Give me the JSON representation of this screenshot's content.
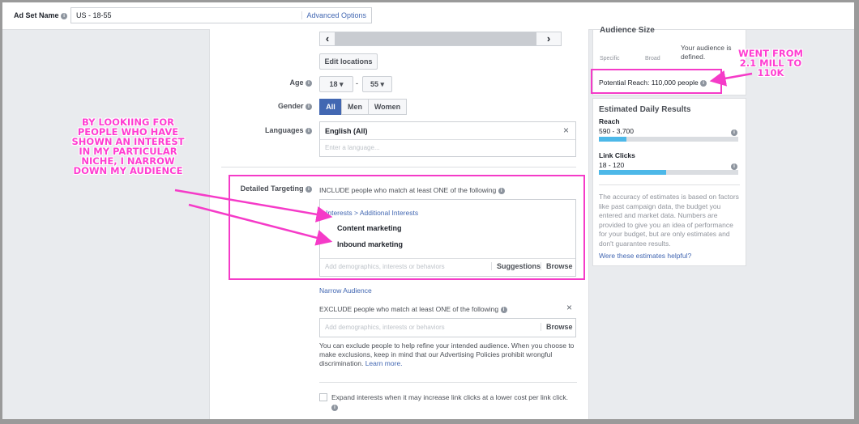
{
  "topbar": {
    "label": "Ad Set Name",
    "value": "US - 18-55",
    "advanced_link": "Advanced Options"
  },
  "location": {
    "scroll_left": "‹",
    "scroll_right": "›",
    "edit_button": "Edit locations"
  },
  "age": {
    "label": "Age",
    "min": "18",
    "max": "55",
    "separator": "-"
  },
  "gender": {
    "label": "Gender",
    "options": [
      "All",
      "Men",
      "Women"
    ],
    "selected": "All"
  },
  "languages": {
    "label": "Languages",
    "selected": "English (All)",
    "placeholder": "Enter a language..."
  },
  "detailed_targeting": {
    "label": "Detailed Targeting",
    "include_text": "INCLUDE people who match at least ONE of the following",
    "breadcrumb": "Interests > Additional Interests",
    "items": [
      "Content marketing",
      "Inbound marketing"
    ],
    "placeholder": "Add demographics, interests or behaviors",
    "suggestions": "Suggestions",
    "browse": "Browse",
    "narrow_link": "Narrow Audience",
    "exclude_text": "EXCLUDE people who match at least ONE of the following",
    "exclude_placeholder": "Add demographics, interests or behaviors",
    "exclude_browse": "Browse",
    "exclude_help": "You can exclude people to help refine your intended audience. When you choose to make exclusions, keep in mind that our Advertising Policies prohibit wrongful discrimination.",
    "learn_more": "Learn more.",
    "expand_label": "Expand interests when it may increase link clicks at a lower cost per link click."
  },
  "audience_size": {
    "title": "Audience Size",
    "specific": "Specific",
    "broad": "Broad",
    "defined_text": "Your audience is defined.",
    "potential_reach": "Potential Reach: 110,000 people"
  },
  "estimated": {
    "title": "Estimated Daily Results",
    "reach_label": "Reach",
    "reach_value": "590 - 3,700",
    "reach_fill": 0.2,
    "clicks_label": "Link Clicks",
    "clicks_value": "18 - 120",
    "clicks_fill": 0.48,
    "note": "The accuracy of estimates is based on factors like past campaign data, the budget you entered and market data. Numbers are provided to give you an idea of performance for your budget, but are only estimates and don't guarantee results.",
    "helpful_link": "Were these estimates helpful?"
  },
  "annotations": {
    "left": "BY LOOKIING FOR PEOPLE WHO HAVE SHOWN AN INTEREST IN MY PARTICULAR NICHE, I NARROW DOWN MY AUDIENCE",
    "right": "WENT FROM 2.1 MILL TO 110K"
  },
  "colors": {
    "highlight": "#f53bc8",
    "accent": "#4267b2",
    "bar": "#4db8e8"
  }
}
